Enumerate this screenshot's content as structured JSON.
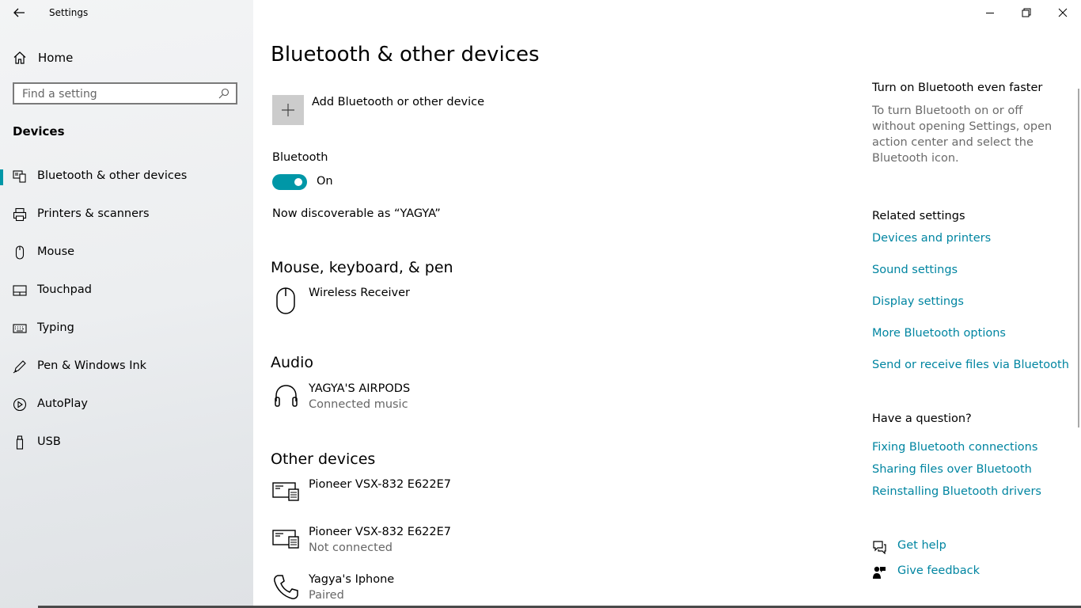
{
  "window": {
    "title": "Settings"
  },
  "sidebar": {
    "home_label": "Home",
    "search_placeholder": "Find a setting",
    "section_label": "Devices",
    "items": [
      {
        "label": "Bluetooth & other devices",
        "icon": "bluetooth-devices-icon",
        "active": true
      },
      {
        "label": "Printers & scanners",
        "icon": "printer-icon"
      },
      {
        "label": "Mouse",
        "icon": "mouse-icon"
      },
      {
        "label": "Touchpad",
        "icon": "touchpad-icon"
      },
      {
        "label": "Typing",
        "icon": "keyboard-icon"
      },
      {
        "label": "Pen & Windows Ink",
        "icon": "pen-icon"
      },
      {
        "label": "AutoPlay",
        "icon": "autoplay-icon"
      },
      {
        "label": "USB",
        "icon": "usb-icon"
      }
    ]
  },
  "main": {
    "title": "Bluetooth & other devices",
    "add_device_label": "Add Bluetooth or other device",
    "bluetooth_label": "Bluetooth",
    "toggle_state": "On",
    "discoverable_text": "Now discoverable as “YAGYA”",
    "groups": {
      "mouse": {
        "title": "Mouse, keyboard, & pen",
        "devices": [
          {
            "name": "Wireless Receiver",
            "status": "",
            "icon": "mouse-icon"
          }
        ]
      },
      "audio": {
        "title": "Audio",
        "devices": [
          {
            "name": "YAGYA'S AIRPODS",
            "status": "Connected music",
            "icon": "headphones-icon"
          }
        ]
      },
      "other": {
        "title": "Other devices",
        "devices": [
          {
            "name": "Pioneer VSX-832 E622E7",
            "status": "",
            "icon": "media-device-icon"
          },
          {
            "name": "Pioneer VSX-832 E622E7",
            "status": "Not connected",
            "icon": "media-device-icon"
          },
          {
            "name": "Yagya's Iphone",
            "status": "Paired",
            "icon": "phone-icon"
          }
        ]
      }
    }
  },
  "aside": {
    "faster_title": "Turn on Bluetooth even faster",
    "faster_text": "To turn Bluetooth on or off without opening Settings, open action center and select the Bluetooth icon.",
    "related_title": "Related settings",
    "related_links": [
      "Devices and printers",
      "Sound settings",
      "Display settings",
      "More Bluetooth options",
      "Send or receive files via Bluetooth"
    ],
    "question_title": "Have a question?",
    "question_links": [
      "Fixing Bluetooth connections",
      "Sharing files over Bluetooth",
      "Reinstalling Bluetooth drivers"
    ],
    "get_help": "Get help",
    "give_feedback": "Give feedback"
  },
  "colors": {
    "accent": "#0097a7",
    "link": "#0085a1",
    "sidebar_bg": "#eceef0"
  }
}
